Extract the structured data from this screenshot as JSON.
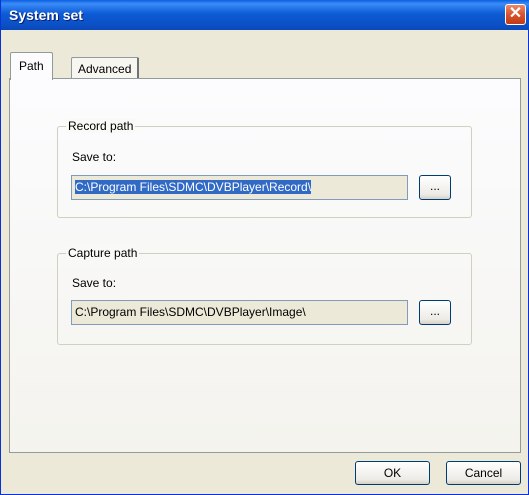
{
  "window": {
    "title": "System set"
  },
  "tabs": [
    {
      "label": "Path",
      "active": true
    },
    {
      "label": "Advanced",
      "active": false
    }
  ],
  "record": {
    "legend": "Record path",
    "save_label": "Save to:",
    "path_value": "C:\\Program Files\\SDMC\\DVBPlayer\\Record\\",
    "browse_label": "..."
  },
  "capture": {
    "legend": "Capture path",
    "save_label": "Save to:",
    "path_value": "C:\\Program Files\\SDMC\\DVBPlayer\\Image\\",
    "browse_label": "..."
  },
  "buttons": {
    "ok": "OK",
    "cancel": "Cancel"
  },
  "colors": {
    "titlebar": "#0b4fc4",
    "close": "#d8542e",
    "selection": "#316ac5",
    "face": "#ece9d8"
  }
}
